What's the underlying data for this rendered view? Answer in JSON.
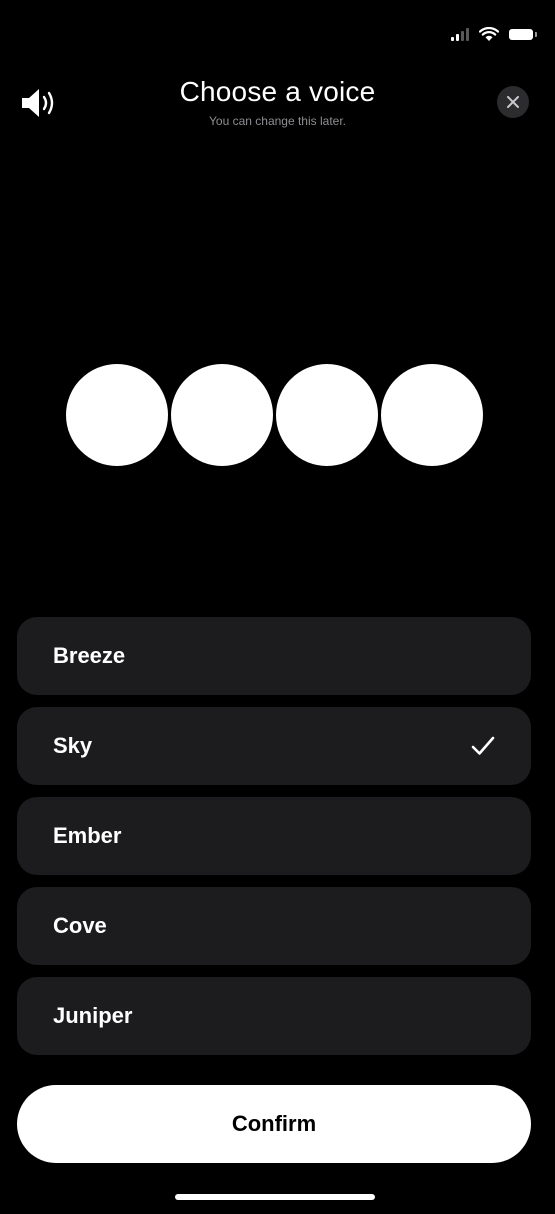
{
  "header": {
    "title": "Choose a voice",
    "subtitle": "You can change this later."
  },
  "icons": {
    "speaker": "speaker-icon",
    "close": "close-icon",
    "check": "checkmark-icon",
    "signal": "cellular-signal-icon",
    "wifi": "wifi-icon",
    "battery": "battery-icon"
  },
  "voices": [
    {
      "label": "Breeze",
      "selected": false
    },
    {
      "label": "Sky",
      "selected": true
    },
    {
      "label": "Ember",
      "selected": false
    },
    {
      "label": "Cove",
      "selected": false
    },
    {
      "label": "Juniper",
      "selected": false
    }
  ],
  "confirm_label": "Confirm",
  "colors": {
    "background": "#000000",
    "card": "#1c1c1e",
    "button": "#ffffff",
    "subtitle": "#8e8e93"
  }
}
